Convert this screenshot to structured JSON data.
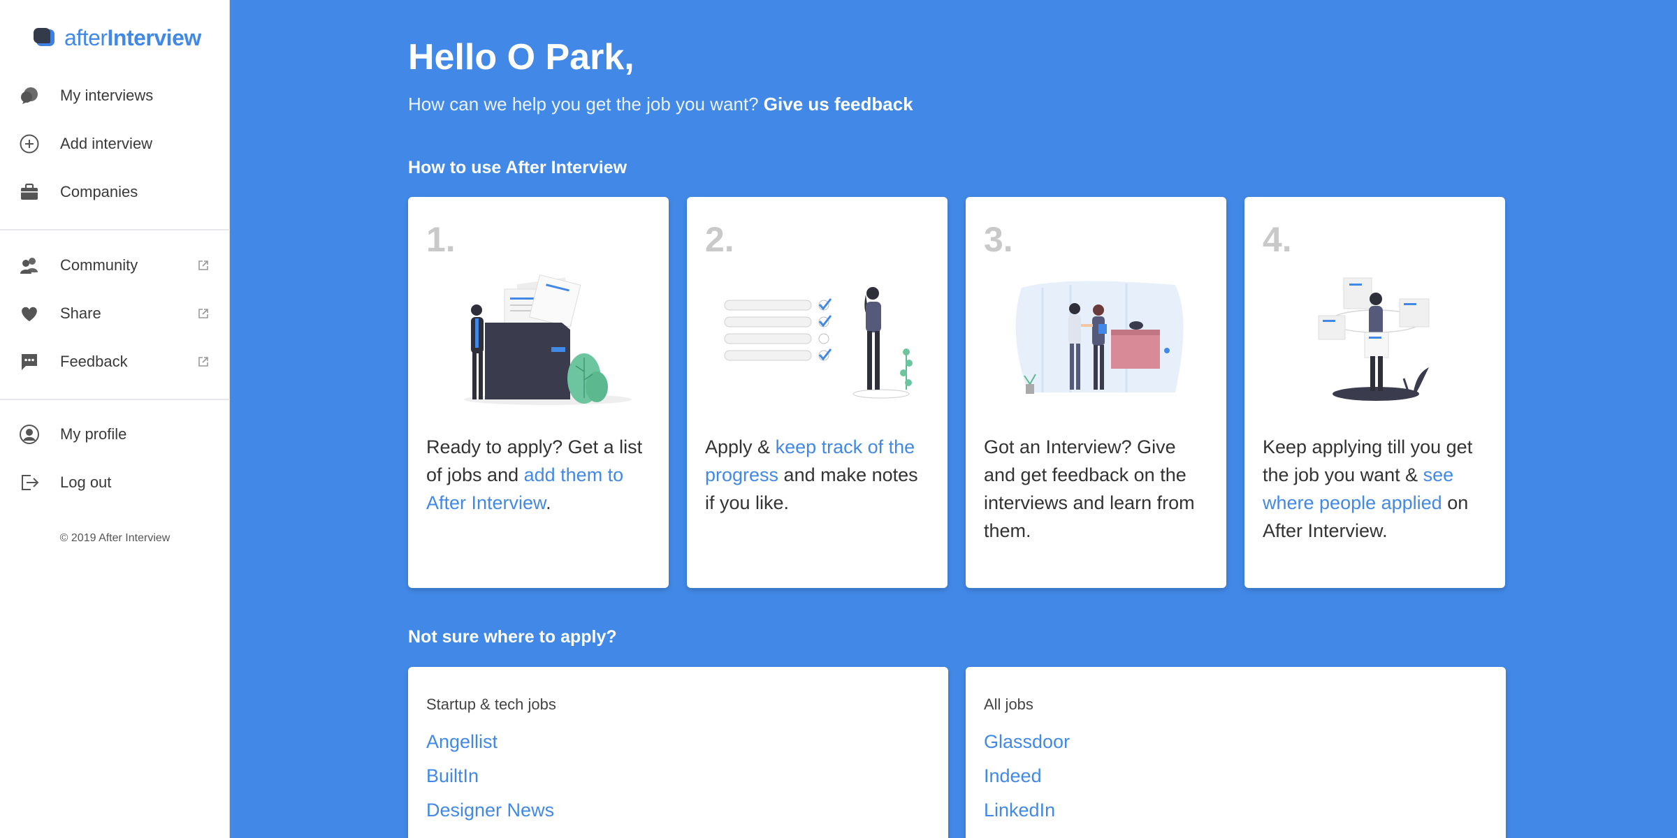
{
  "brand": {
    "name_part1": "after",
    "name_part2": "Interview"
  },
  "sidebar": {
    "items": [
      {
        "label": "My interviews",
        "icon": "chat-bubbles-icon",
        "external": false
      },
      {
        "label": "Add interview",
        "icon": "plus-circle-icon",
        "external": false
      },
      {
        "label": "Companies",
        "icon": "briefcase-icon",
        "external": false
      },
      {
        "label": "Community",
        "icon": "people-icon",
        "external": true
      },
      {
        "label": "Share",
        "icon": "heart-icon",
        "external": true
      },
      {
        "label": "Feedback",
        "icon": "message-dots-icon",
        "external": true
      },
      {
        "label": "My profile",
        "icon": "user-circle-icon",
        "external": false
      },
      {
        "label": "Log out",
        "icon": "logout-icon",
        "external": false
      }
    ],
    "copyright": "© 2019 After Interview"
  },
  "main": {
    "greeting": "Hello O Park,",
    "subline_text": "How can we help you get the job you want?",
    "subline_link": "Give us feedback",
    "howto_title": "How to use After Interview",
    "steps": [
      {
        "num": "1.",
        "t1": "Ready to apply? Get a list of jobs and ",
        "link": "add them to After Interview",
        "t2": "."
      },
      {
        "num": "2.",
        "t1": "Apply & ",
        "link": "keep track of the progress",
        "t2": " and make notes if you like."
      },
      {
        "num": "3.",
        "t1": "Got an Interview? Give and get feedback on the interviews and learn from them.",
        "link": "",
        "t2": ""
      },
      {
        "num": "4.",
        "t1": "Keep applying till you get the job you want & ",
        "link": "see where people applied",
        "t2": " on After Interview."
      }
    ],
    "apply_title": "Not sure where to apply?",
    "job_lists": [
      {
        "title": "Startup & tech jobs",
        "links": [
          "Angellist",
          "BuiltIn",
          "Designer News"
        ]
      },
      {
        "title": "All jobs",
        "links": [
          "Glassdoor",
          "Indeed",
          "LinkedIn"
        ]
      }
    ]
  },
  "colors": {
    "accent": "#4289E7",
    "sidebar_bg": "#ffffff",
    "card_number": "#c9c9c9"
  }
}
